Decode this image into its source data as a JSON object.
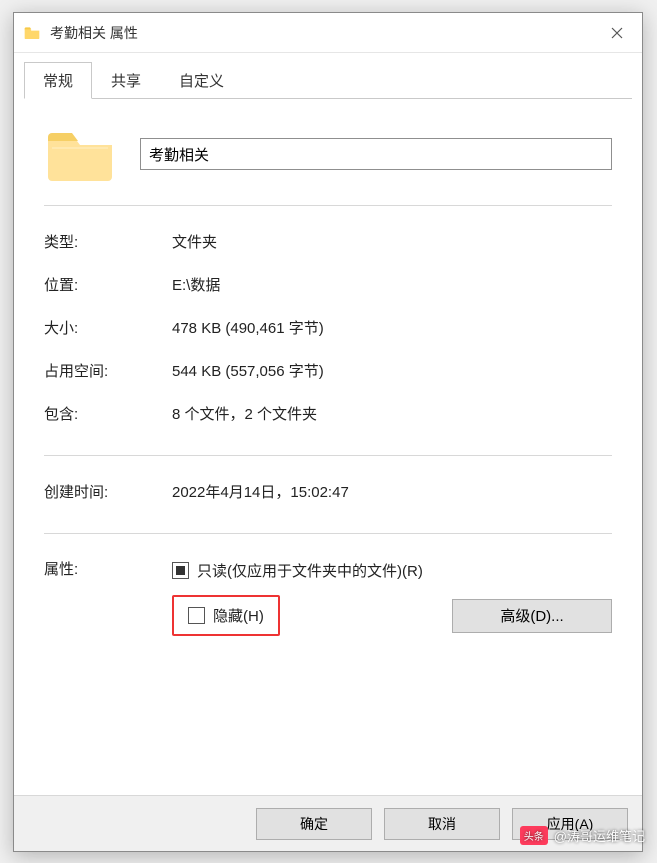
{
  "titlebar": {
    "title": "考勤相关 属性"
  },
  "tabs": {
    "general": "常规",
    "share": "共享",
    "custom": "自定义"
  },
  "folder": {
    "name": "考勤相关"
  },
  "labels": {
    "type": "类型:",
    "location": "位置:",
    "size": "大小:",
    "sizeOnDisk": "占用空间:",
    "contains": "包含:",
    "created": "创建时间:",
    "attributes": "属性:"
  },
  "values": {
    "type": "文件夹",
    "location": "E:\\数据",
    "size": "478 KB (490,461 字节)",
    "sizeOnDisk": "544 KB (557,056 字节)",
    "contains": "8 个文件，2 个文件夹",
    "created": "2022年4月14日，15:02:47"
  },
  "attributes": {
    "readonly_label": "只读(仅应用于文件夹中的文件)(R)",
    "hidden_label": "隐藏(H)",
    "advanced": "高级(D)..."
  },
  "buttons": {
    "ok": "确定",
    "cancel": "取消",
    "apply": "应用(A)"
  },
  "watermark": {
    "badge": "头条",
    "text": "@涛哥运维笔记"
  }
}
